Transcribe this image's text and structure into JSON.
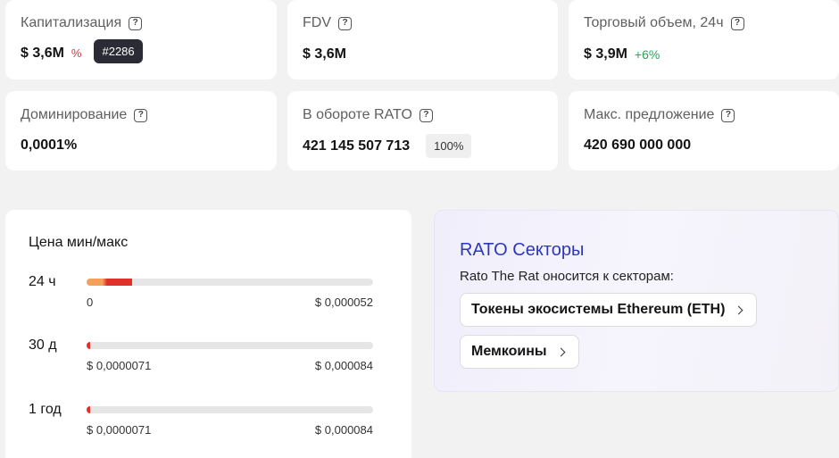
{
  "stats": {
    "market_cap": {
      "label": "Капитализация",
      "value": "$ 3,6M",
      "change": "%",
      "rank": "#2286"
    },
    "fdv": {
      "label": "FDV",
      "value": "$ 3,6M"
    },
    "volume": {
      "label": "Торговый объем, 24ч",
      "value": "$ 3,9M",
      "change": "+6%"
    },
    "dominance": {
      "label": "Доминирование",
      "value": "0,0001%"
    },
    "circulating": {
      "label": "В обороте RATO",
      "value": "421 145 507 713",
      "percent": "100%"
    },
    "max_supply": {
      "label": "Макс. предложение",
      "value": "420 690 000 000"
    }
  },
  "price_range": {
    "title": "Цена мин/макс",
    "rows": [
      {
        "period": "24 ч",
        "low": "0",
        "high": "$ 0,000052",
        "fill_fraction": 0.16
      },
      {
        "period": "30 д",
        "low": "$ 0,0000071",
        "high": "$ 0,000084",
        "fill_fraction": 0.01
      },
      {
        "period": "1 год",
        "low": "$ 0,0000071",
        "high": "$ 0,000084",
        "fill_fraction": 0.01
      }
    ]
  },
  "sectors": {
    "title": "RATO Секторы",
    "description": "Rato The Rat оносится к секторам:",
    "items": [
      {
        "label": "Токены экосистемы Ethereum (ETH)"
      },
      {
        "label": "Мемкоины"
      }
    ]
  },
  "icons": {
    "info": "question-mark-icon",
    "chevron": "chevron-right-icon"
  },
  "colors": {
    "negative": "#e0303a",
    "positive": "#2ea35a",
    "accent": "#2b38b8",
    "bar_start": "#f5a05a",
    "bar_end": "#e0302a"
  }
}
